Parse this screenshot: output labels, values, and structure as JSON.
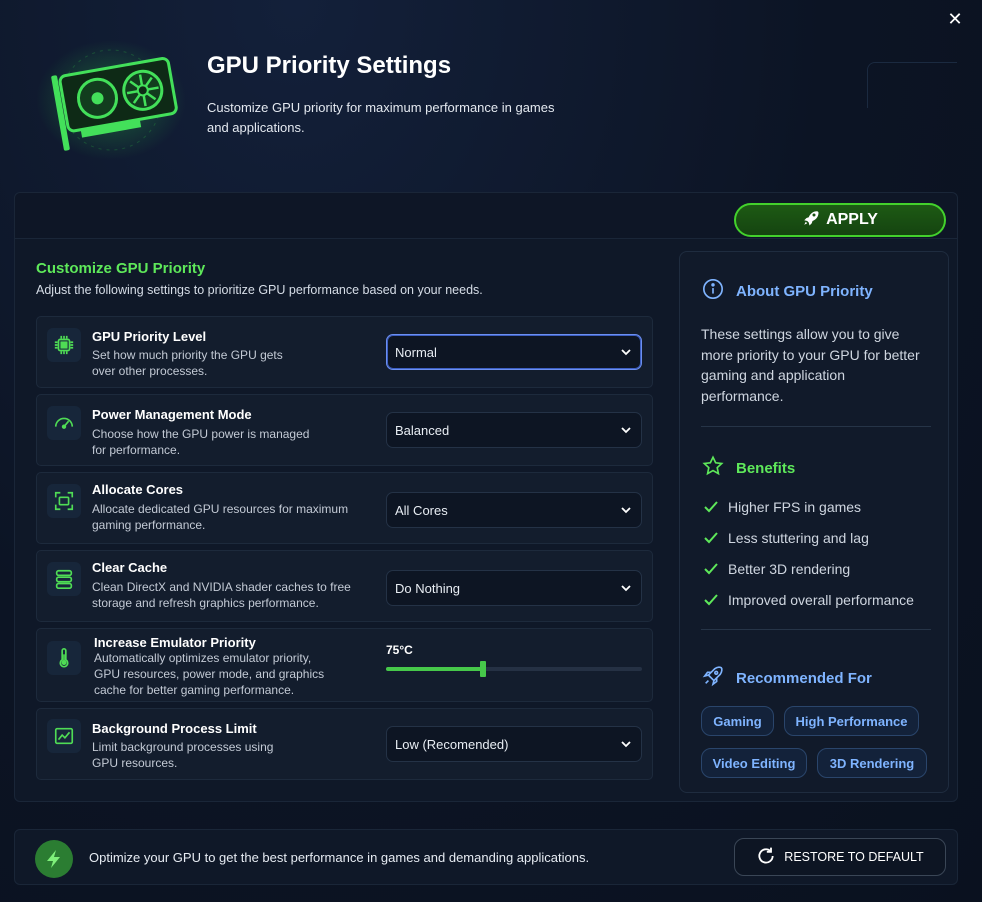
{
  "header": {
    "title": "GPU Priority Settings",
    "subtitle": "Customize GPU priority for maximum performance in games and applications."
  },
  "toolbar": {
    "apply_label": "APPLY"
  },
  "section": {
    "title": "Customize GPU Priority",
    "subtitle": "Adjust the following settings to prioritize GPU performance based on your needs."
  },
  "settings": [
    {
      "icon": "chip-icon",
      "title": "GPU Priority Level",
      "desc": "Set how much priority the GPU gets over other processes.",
      "value": "Normal"
    },
    {
      "icon": "gauge-icon",
      "title": "Power Management Mode",
      "desc": "Choose how the GPU power is managed for performance.",
      "value": "Balanced"
    },
    {
      "icon": "cores-icon",
      "title": "Allocate Cores",
      "desc": "Allocate dedicated GPU resources for maximum gaming performance.",
      "value": "All Cores"
    },
    {
      "icon": "database-icon",
      "title": "Clear Cache",
      "desc": "Clean DirectX and NVIDIA shader caches to free storage and refresh graphics performance.",
      "value": "Do Nothing"
    },
    {
      "icon": "thermometer-icon",
      "title": "Increase Emulator Priority",
      "desc": "Automatically optimizes emulator priority, GPU resources, power mode, and graphics cache for better gaming performance.",
      "value": "75°C",
      "level": 0.38
    },
    {
      "icon": "chart-icon",
      "title": "Background Process Limit",
      "desc": "Limit background processes using GPU resources.",
      "value": "Low (Recomended)"
    }
  ],
  "side": {
    "about_title": "About GPU Priority",
    "about_text": "These settings allow you to give more priority to your GPU for better gaming and application performance.",
    "benefits_title": "Benefits",
    "benefits": [
      "Higher FPS in games",
      "Less stuttering and lag",
      "Better 3D rendering",
      "Improved overall performance"
    ],
    "recommended_title": "Recommended For",
    "recommended": [
      "Gaming",
      "High Performance",
      "Video Editing",
      "3D Rendering"
    ]
  },
  "footer": {
    "text": "Optimize your GPU to get the best performance in games and demanding applications.",
    "restore_label": "RESTORE TO DEFAULT"
  },
  "colors": {
    "accent_green": "#5ee85a",
    "accent_blue": "#7fb4ff",
    "background": "#0d1525"
  }
}
